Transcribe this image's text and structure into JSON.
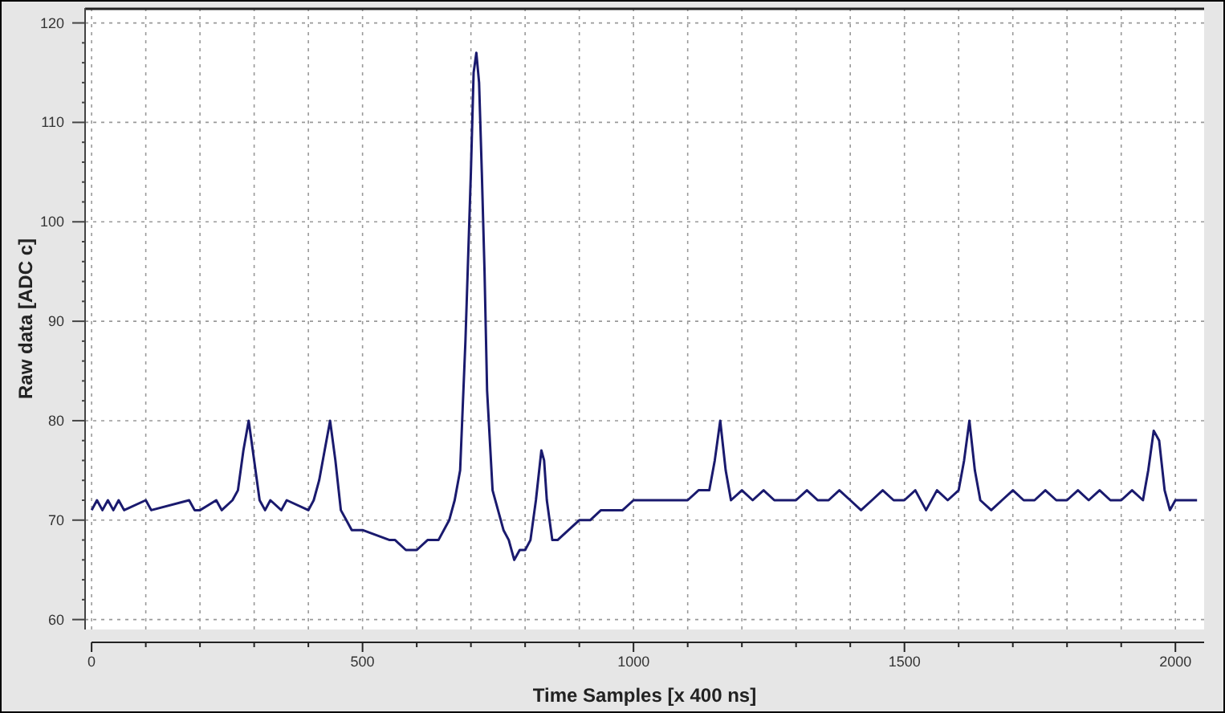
{
  "plot": {
    "chart_data": {
      "type": "line",
      "xlabel": "Time Samples [x 400 ns]",
      "ylabel": "Raw data [ADC c]",
      "xlim": [
        -12,
        2053
      ],
      "ylim": [
        59,
        121.5
      ],
      "xticks": [
        0,
        500,
        1000,
        1500,
        2000
      ],
      "yticks": [
        60,
        70,
        80,
        90,
        100,
        110,
        120
      ],
      "x": [
        0,
        10,
        20,
        30,
        40,
        50,
        60,
        100,
        110,
        180,
        190,
        200,
        230,
        240,
        260,
        270,
        280,
        290,
        300,
        310,
        320,
        330,
        350,
        360,
        400,
        410,
        420,
        430,
        440,
        450,
        460,
        470,
        480,
        500,
        550,
        560,
        580,
        600,
        620,
        640,
        660,
        670,
        680,
        690,
        700,
        705,
        710,
        715,
        720,
        725,
        730,
        740,
        750,
        760,
        770,
        780,
        790,
        800,
        810,
        820,
        830,
        835,
        840,
        850,
        860,
        880,
        900,
        920,
        940,
        960,
        980,
        1000,
        1020,
        1040,
        1060,
        1080,
        1100,
        1120,
        1140,
        1150,
        1160,
        1170,
        1180,
        1200,
        1220,
        1240,
        1260,
        1280,
        1300,
        1320,
        1340,
        1360,
        1380,
        1400,
        1420,
        1440,
        1460,
        1480,
        1500,
        1520,
        1540,
        1560,
        1580,
        1600,
        1610,
        1620,
        1630,
        1640,
        1660,
        1680,
        1700,
        1720,
        1740,
        1760,
        1780,
        1800,
        1820,
        1840,
        1860,
        1880,
        1900,
        1920,
        1940,
        1950,
        1960,
        1970,
        1980,
        1990,
        2000,
        2020,
        2040
      ],
      "grid": true,
      "series": [
        {
          "color": "#1a1a6e",
          "values": [
            71,
            72,
            71,
            72,
            71,
            72,
            71,
            72,
            71,
            72,
            71,
            71,
            72,
            71,
            72,
            73,
            77,
            80,
            76,
            72,
            71,
            72,
            71,
            72,
            71,
            72,
            74,
            77,
            80,
            76,
            71,
            70,
            69,
            69,
            68,
            68,
            67,
            67,
            68,
            68,
            70,
            72,
            75,
            88,
            105,
            115,
            117,
            114,
            105,
            95,
            83,
            73,
            71,
            69,
            68,
            66,
            67,
            67,
            68,
            72,
            77,
            76,
            72,
            68,
            68,
            69,
            70,
            70,
            71,
            71,
            71,
            72,
            72,
            72,
            72,
            72,
            72,
            73,
            73,
            76,
            80,
            75,
            72,
            73,
            72,
            73,
            72,
            72,
            72,
            73,
            72,
            72,
            73,
            72,
            71,
            72,
            73,
            72,
            72,
            73,
            71,
            73,
            72,
            73,
            76,
            80,
            75,
            72,
            71,
            72,
            73,
            72,
            72,
            73,
            72,
            72,
            73,
            72,
            73,
            72,
            72,
            73,
            72,
            75,
            79,
            78,
            73,
            71,
            72,
            72,
            72
          ]
        }
      ]
    }
  }
}
